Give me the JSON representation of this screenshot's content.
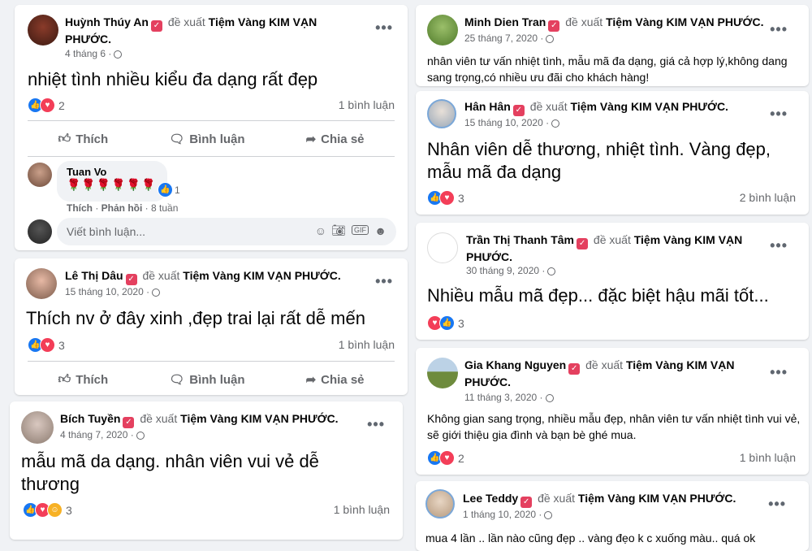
{
  "colors": {
    "like": "#1877f2",
    "love": "#f33e58",
    "badge": "#e4405f"
  },
  "recommend_text": "đề xuất",
  "page_name": "Tiệm Vàng KIM VẠN PHƯỚC.",
  "actions": {
    "like": "Thích",
    "comment": "Bình luận",
    "share": "Chia sẻ"
  },
  "posts": [
    {
      "author": "Huỳnh Thúy An",
      "date": "4 tháng 6 ·",
      "text": "nhiệt tình nhiều kiểu đa dạng rất đẹp",
      "reactions": "2",
      "comments": "1 bình luận"
    },
    {
      "author": "Lê Thị Dâu",
      "date": "15 tháng 10, 2020 ·",
      "text": "Thích nv ở đây xinh ,đẹp trai lại rất dễ mến",
      "reactions": "3",
      "comments": "1 bình luận"
    },
    {
      "author": "Bích Tuyền",
      "date": "4 tháng 7, 2020 ·",
      "text": "mẫu mã da dạng. nhân viên vui vẻ dễ thương",
      "reactions": "3",
      "comments": "1 bình luận"
    },
    {
      "author": "Minh Dien Tran",
      "date": "25 tháng 7, 2020 ·",
      "text": "nhân viên tư vấn nhiệt tình, mẫu mã đa dạng, giá cả hợp lý,không dang sang trọng,có nhiều ưu đãi cho khách hàng!"
    },
    {
      "author": "Hân Hân",
      "date": "15 tháng 10, 2020 ·",
      "text": "Nhân viên dễ thương, nhiệt tình. Vàng đẹp, mẫu mã đa dạng",
      "reactions": "3",
      "comments": "2 bình luận"
    },
    {
      "author": "Trần Thị Thanh Tâm",
      "date": "30 tháng 9, 2020 ·",
      "text": "Nhiều mẫu mã đẹp... đặc biệt hậu mãi tốt...",
      "reactions": "3"
    },
    {
      "author": "Gia Khang Nguyen",
      "date": "11 tháng 3, 2020 ·",
      "text": "Không gian sang trọng, nhiều mẫu đẹp, nhân viên tư vấn nhiệt tình vui vẻ, sẽ giới thiệu gia đình và bạn bè ghé mua.",
      "reactions": "2",
      "comments": "1 bình luận"
    },
    {
      "author": "Lee Teddy",
      "date": "1 tháng 10, 2020 ·",
      "text": "mua 4 lần .. lần nào cũng đẹp .. vàng đẹo k c xuống màu.. quá ok"
    }
  ],
  "comment": {
    "author": "Tuan Vo",
    "reaction_count": "1",
    "like": "Thích",
    "reply": "Phản hồi",
    "time": "8 tuần"
  },
  "comment_placeholder": "Viết bình luận..."
}
